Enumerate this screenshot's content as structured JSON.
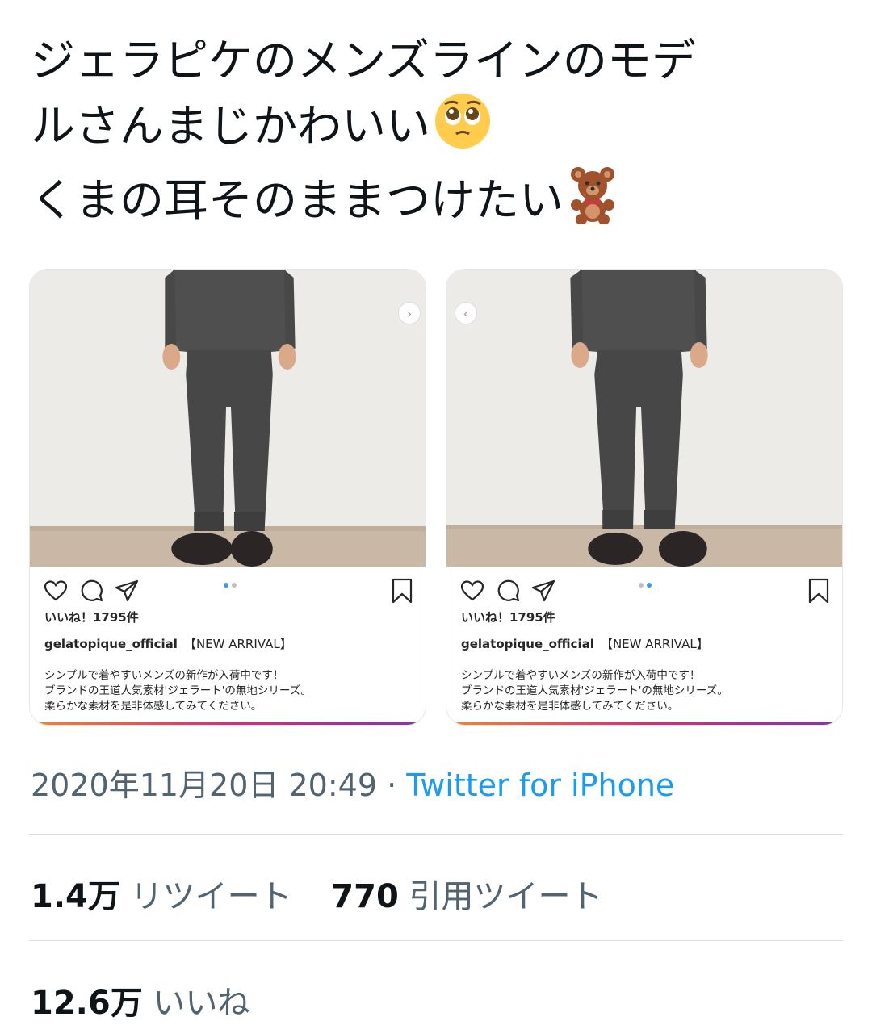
{
  "tweet": {
    "lines": [
      "ジェラピケのメンズラインのモデ",
      "ルさんまじかわいい",
      "くまの耳そのままつけたい"
    ],
    "emoji_1": "pleading-face-emoji",
    "emoji_2": "teddy-bear-emoji"
  },
  "instagram_cards": [
    {
      "likes": "いいね！1795件",
      "username": "gelatopique_official",
      "tag": "【NEW ARRIVAL】",
      "caption": [
        "シンプルで着やすいメンズの新作が入荷中です！",
        "ブランドの王道人気素材'ジェラート'の無地シリーズ。",
        "柔らかな素材を是非体感してみてください。"
      ],
      "active_dot": 1,
      "nav": "next"
    },
    {
      "likes": "いいね！1795件",
      "username": "gelatopique_official",
      "tag": "【NEW ARRIVAL】",
      "caption": [
        "シンプルで着やすいメンズの新作が入荷中です！",
        "ブランドの王道人気素材'ジェラート'の無地シリーズ。",
        "柔らかな素材を是非体感してみてください。"
      ],
      "active_dot": 2,
      "nav": "prev"
    }
  ],
  "meta": {
    "timestamp": "2020年11月20日 20:49",
    "separator": " · ",
    "source": "Twitter for iPhone"
  },
  "stats": {
    "retweets_count": "1.4万",
    "retweets_label": "リツイート",
    "quotes_count": "770",
    "quotes_label": "引用ツイート",
    "likes_count": "12.6万",
    "likes_label": "いいね"
  },
  "colors": {
    "text": "#0f1419",
    "secondary": "#536471",
    "link": "#1d9bf0",
    "ig_blue": "#3897f0"
  }
}
